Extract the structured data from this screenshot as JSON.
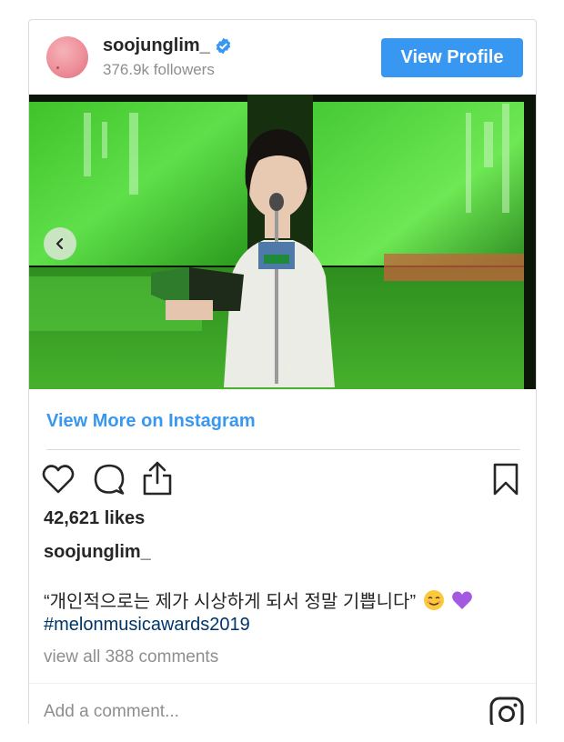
{
  "header": {
    "username": "soojunglim_",
    "followers": "376.9k followers",
    "view_profile_label": "View Profile"
  },
  "post": {
    "view_more_label": "View More on Instagram",
    "likes": "42,621 likes",
    "author": "soojunglim_",
    "caption_text": "“개인적으로는 제가 시상하게 되서 정말 기쁩니다”",
    "hashtag": "#melonmusicawards2019",
    "comments_link": "view all 388 comments",
    "add_comment_placeholder": "Add a comment..."
  },
  "icons": {
    "verified": "verified-badge-icon",
    "like": "heart-icon",
    "comment": "comment-icon",
    "share": "share-icon",
    "save": "bookmark-icon",
    "instagram": "instagram-logo-icon",
    "prev": "chevron-left-icon",
    "emoji_1": "smiling-face-emoji",
    "emoji_2": "purple-heart-emoji"
  },
  "colors": {
    "accent": "#3897f0",
    "text": "#262626",
    "muted": "#8e8e8e",
    "hashtag": "#003569"
  }
}
